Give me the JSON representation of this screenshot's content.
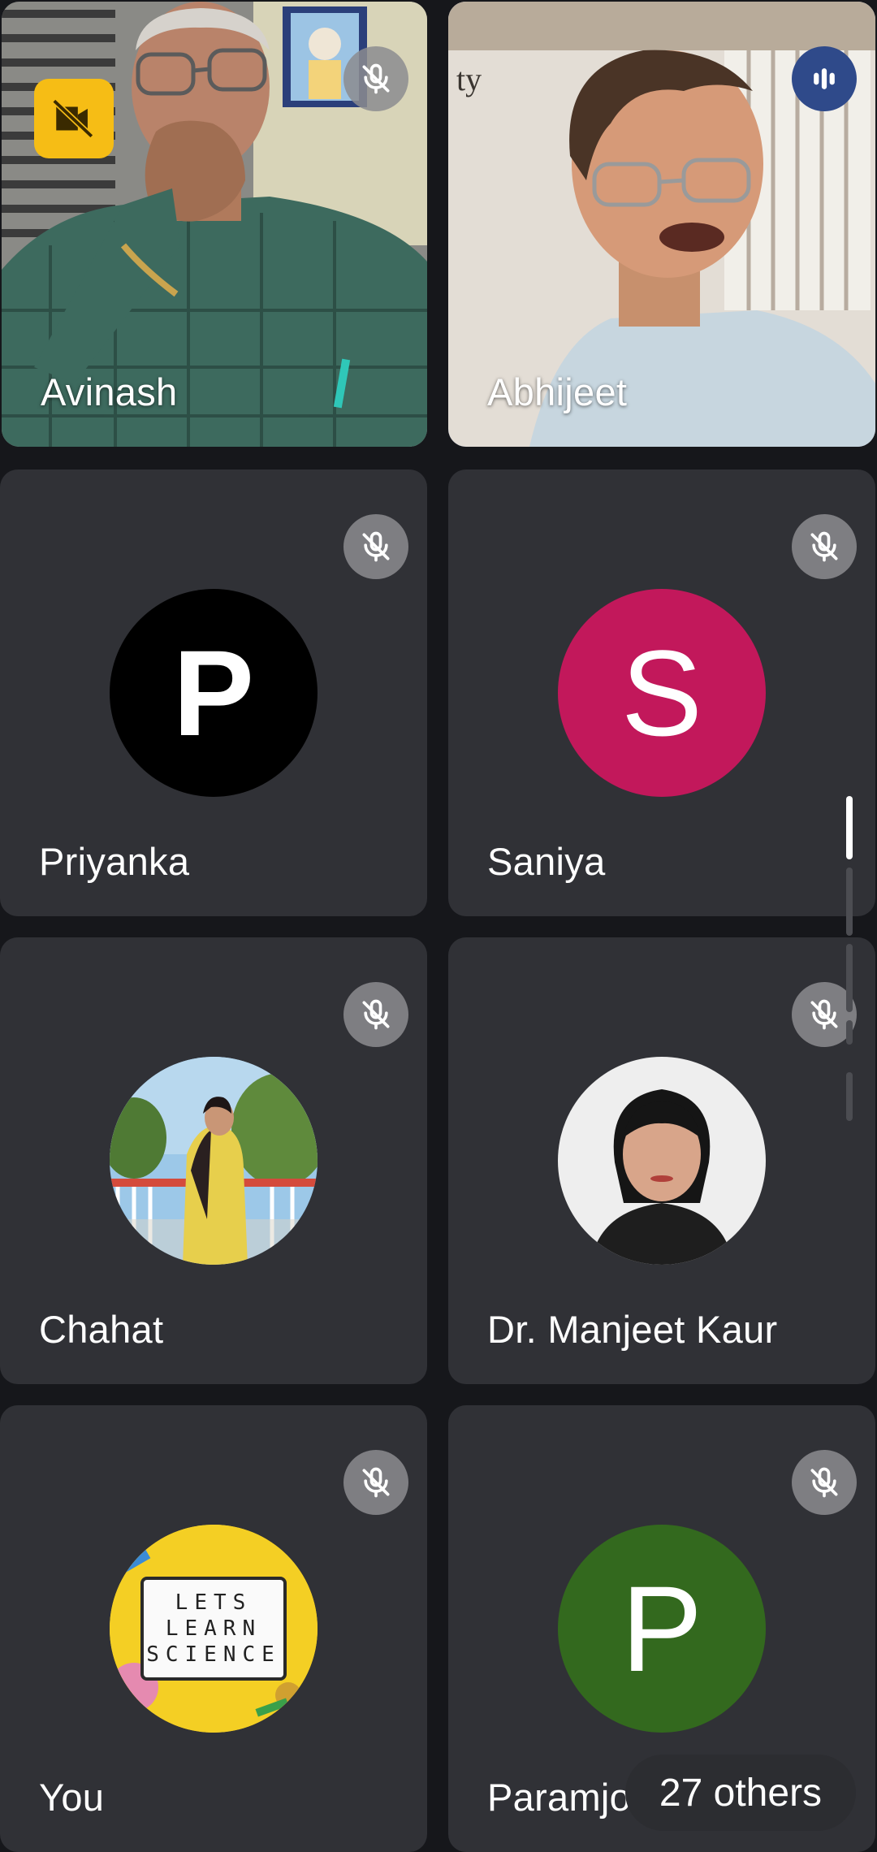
{
  "participants": [
    {
      "name": "Avinash",
      "status": "muted",
      "video": true,
      "video_badge": "video-off-icon"
    },
    {
      "name": "Abhijeet",
      "status": "speaking",
      "video": true
    },
    {
      "name": "Priyanka",
      "status": "muted",
      "avatar_letter": "P",
      "avatar_color": "#000000"
    },
    {
      "name": "Saniya",
      "status": "muted",
      "avatar_letter": "S",
      "avatar_color": "#c2185b"
    },
    {
      "name": "Chahat",
      "status": "muted",
      "avatar_type": "photo"
    },
    {
      "name": "Dr. Manjeet Kaur",
      "status": "muted",
      "avatar_type": "photo"
    },
    {
      "name": "You",
      "status": "muted",
      "avatar_type": "photo"
    },
    {
      "name": "Paramjot",
      "status": "muted",
      "avatar_letter": "P",
      "avatar_color": "#33691e"
    }
  ],
  "abhijeet_wall_text": "ty",
  "you_avatar_sign": [
    "LETS",
    "LEARN",
    "SCIENCE"
  ],
  "others_chip": "27 others",
  "colors": {
    "background": "#16171b",
    "tile": "#303136",
    "speaking_border": "#4a6aa6",
    "video_off_badge": "#f6bd15"
  }
}
